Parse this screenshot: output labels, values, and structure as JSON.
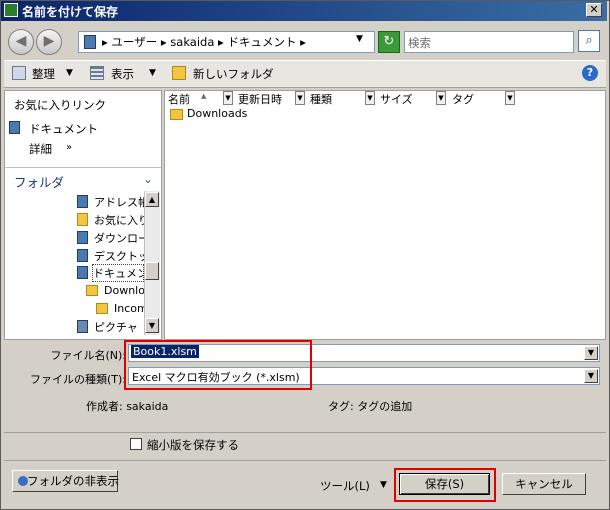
{
  "window": {
    "title": "名前を付けて保存"
  },
  "nav": {
    "breadcrumb": "▸ ユーザー ▸ sakaida ▸ ドキュメント ▸",
    "search_placeholder": "検索"
  },
  "toolbar": {
    "organize": "整理",
    "views": "表示",
    "new_folder": "新しいフォルダ"
  },
  "left": {
    "favorites_heading": "お気に入りリンク",
    "documents": "ドキュメント",
    "details": "詳細",
    "folders_heading": "フォルダ",
    "tree": [
      "アドレス帳",
      "お気に入り",
      "ダウンロード",
      "デスクトップ",
      "ドキュメント",
      "Downloads",
      "Incoming",
      "ピクチャ"
    ]
  },
  "list": {
    "columns": [
      "名前",
      "更新日時",
      "種類",
      "サイズ",
      "タグ"
    ],
    "rows": [
      "Downloads"
    ]
  },
  "form": {
    "filename_label": "ファイル名(N):",
    "filename_value": "Book1.xlsm",
    "filetype_label": "ファイルの種類(T):",
    "filetype_value": "Excel マクロ有効ブック (*.xlsm)",
    "author": "作成者: sakaida",
    "tags": "タグ: タグの追加",
    "thumbnail": "縮小版を保存する"
  },
  "buttons": {
    "hide_folders": "フォルダの非表示",
    "tools": "ツール(L)",
    "save": "保存(S)",
    "cancel": "キャンセル"
  },
  "colors": {
    "highlight": "#e00000",
    "selection": "#0a246a"
  }
}
